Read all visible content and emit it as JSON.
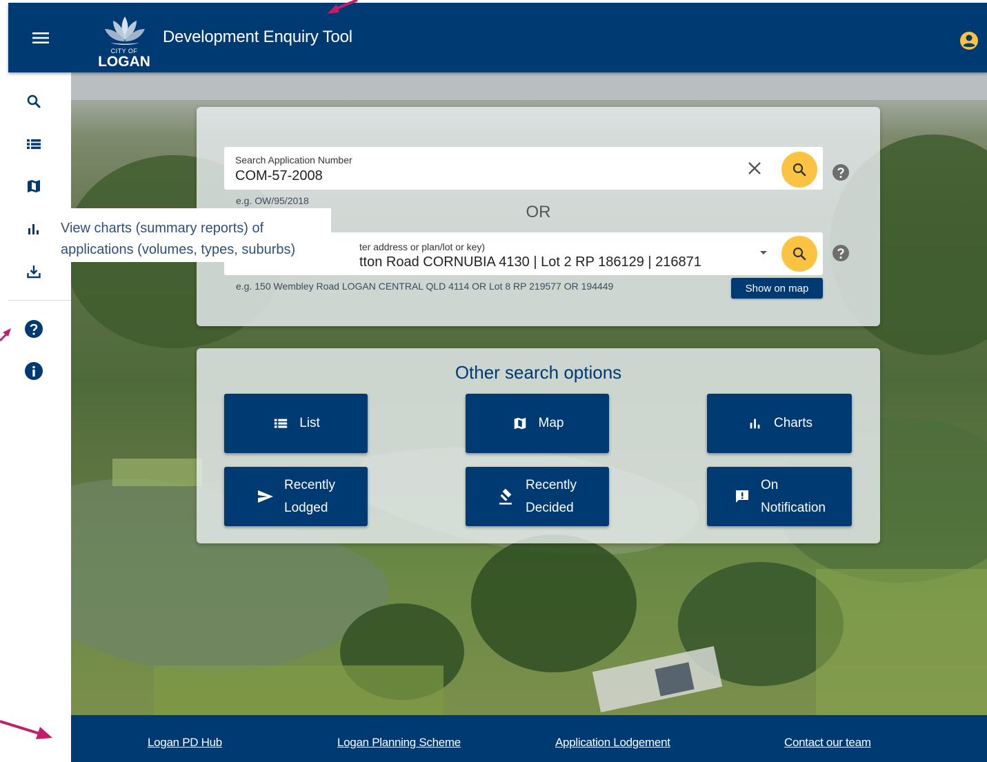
{
  "header": {
    "menu_icon": "hamburger-menu-icon",
    "logo_city": "CITY OF",
    "logo_name": "LOGAN",
    "title": "Development Enquiry Tool",
    "account_icon": "account-circle-icon"
  },
  "sidebar": {
    "items": [
      {
        "name": "search",
        "icon": "search-icon"
      },
      {
        "name": "list",
        "icon": "list-icon"
      },
      {
        "name": "map",
        "icon": "map-icon"
      },
      {
        "name": "charts",
        "icon": "bar-chart-icon"
      },
      {
        "name": "download",
        "icon": "download-icon"
      },
      {
        "name": "help",
        "icon": "help-icon"
      },
      {
        "name": "info",
        "icon": "info-icon"
      }
    ],
    "tooltip": "View charts (summary reports) of applications (volumes, types, suburbs)"
  },
  "search": {
    "app_number_label": "Search Application Number",
    "app_number_value": "COM-57-2008",
    "app_number_hint": "e.g. OW/95/2018",
    "or_text": "OR",
    "address_label_visible": "ter address or plan/lot or key)",
    "address_value_visible": "tton Road CORNUBIA  4130 | Lot 2 RP 186129 | 216871",
    "address_hint": "e.g. 150 Wembley Road LOGAN CENTRAL QLD 4114 OR Lot 8 RP 219577 OR 194449",
    "show_on_map": "Show on map"
  },
  "options": {
    "title": "Other search options",
    "buttons": [
      {
        "icon": "list-icon",
        "line1": "List",
        "line2": ""
      },
      {
        "icon": "map-icon",
        "line1": "Map",
        "line2": ""
      },
      {
        "icon": "bar-chart-icon",
        "line1": "Charts",
        "line2": ""
      },
      {
        "icon": "send-icon",
        "line1": "Recently",
        "line2": "Lodged"
      },
      {
        "icon": "gavel-icon",
        "line1": "Recently",
        "line2": "Decided"
      },
      {
        "icon": "feedback-icon",
        "line1": "On",
        "line2": "Notification"
      }
    ]
  },
  "footer": {
    "links": [
      "Logan PD Hub",
      "Logan Planning Scheme",
      "Application Lodgement",
      "Contact our team"
    ]
  },
  "colors": {
    "brand_navy": "#003a73",
    "search_button": "#fcc242",
    "annotation_arrow": "#c21d6b"
  }
}
